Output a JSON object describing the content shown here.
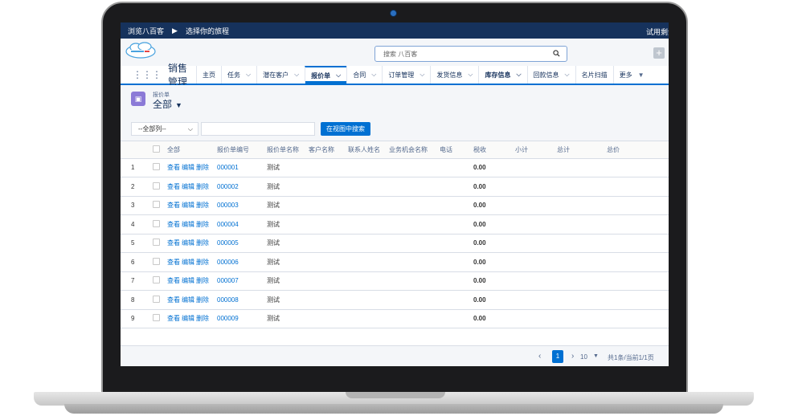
{
  "topbar": {
    "crumb": "浏览八百客",
    "action": "选择你的旅程",
    "trial": "试用剩余"
  },
  "header": {
    "logo_text": "8",
    "search_placeholder": "搜索 八百客"
  },
  "nav": {
    "app_name": "销售管理",
    "tabs": [
      {
        "label": "主页",
        "dropdown": false
      },
      {
        "label": "任务",
        "dropdown": true
      },
      {
        "label": "潜在客户",
        "dropdown": true
      },
      {
        "label": "报价单",
        "dropdown": true,
        "active": true
      },
      {
        "label": "合同",
        "dropdown": true
      },
      {
        "label": "订单管理",
        "dropdown": true
      },
      {
        "label": "发货信息",
        "dropdown": true
      },
      {
        "label": "库存信息",
        "dropdown": true
      },
      {
        "label": "回款信息",
        "dropdown": true
      },
      {
        "label": "名片扫描",
        "dropdown": false
      },
      {
        "label": "更多",
        "dropdown": true
      }
    ]
  },
  "list": {
    "object_label": "报价单",
    "view_name": "全部",
    "column_select": "--全部列--",
    "search_button": "在视图中搜索",
    "columns": [
      "全部",
      "报价单编号",
      "报价单名称",
      "客户名称",
      "联系人姓名",
      "业务机会名称",
      "电话",
      "税收",
      "小计",
      "总计",
      "总价"
    ],
    "action_labels": [
      "查看",
      "编辑",
      "删除"
    ],
    "rows": [
      {
        "idx": "1",
        "no": "000001",
        "name": "测试",
        "tax": "0.00"
      },
      {
        "idx": "2",
        "no": "000002",
        "name": "测试",
        "tax": "0.00"
      },
      {
        "idx": "3",
        "no": "000003",
        "name": "测试",
        "tax": "0.00"
      },
      {
        "idx": "4",
        "no": "000004",
        "name": "测试",
        "tax": "0.00"
      },
      {
        "idx": "5",
        "no": "000005",
        "name": "测试",
        "tax": "0.00"
      },
      {
        "idx": "6",
        "no": "000006",
        "name": "测试",
        "tax": "0.00"
      },
      {
        "idx": "7",
        "no": "000007",
        "name": "测试",
        "tax": "0.00"
      },
      {
        "idx": "8",
        "no": "000008",
        "name": "测试",
        "tax": "0.00"
      },
      {
        "idx": "9",
        "no": "000009",
        "name": "测试",
        "tax": "0.00"
      }
    ]
  },
  "pager": {
    "current_page": "1",
    "page_size": "10",
    "info": "共1条/当前1/1页"
  },
  "colors": {
    "brand_dark": "#16325c",
    "accent": "#0070d2",
    "object_icon": "#8b7ad7"
  }
}
